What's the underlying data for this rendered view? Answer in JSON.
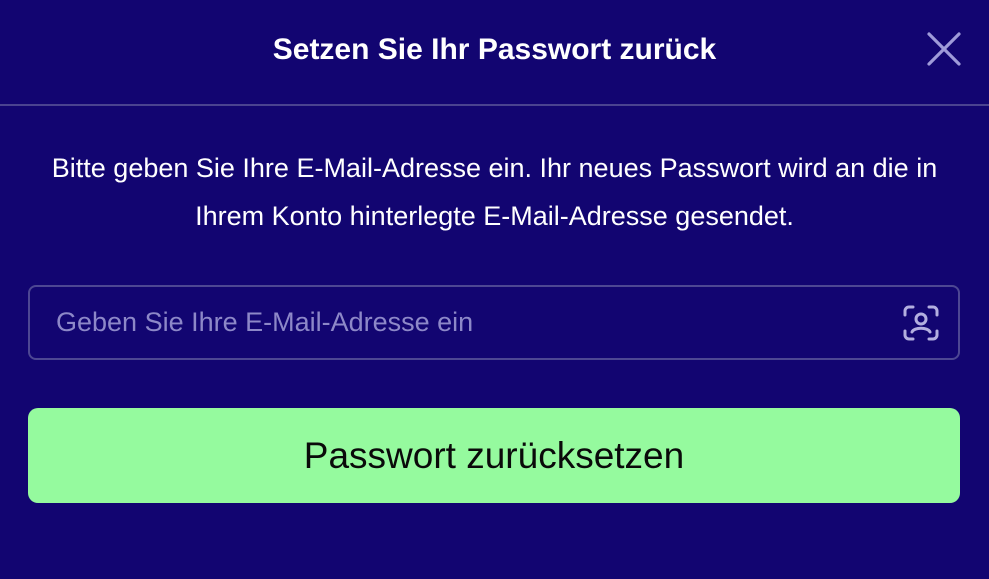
{
  "dialog": {
    "title": "Setzen Sie Ihr Passwort zurück",
    "close_icon": "close-icon",
    "description": "Bitte geben Sie Ihre E-Mail-Adresse ein. Ihr neues Passwort wird an die in Ihrem Konto hinterlegte E-Mail-Adresse gesendet.",
    "email": {
      "value": "",
      "placeholder": "Geben Sie Ihre E-Mail-Adresse ein",
      "icon": "contact-card-icon"
    },
    "submit_label": "Passwort zurücksetzen"
  },
  "colors": {
    "background": "#120571",
    "divider": "#4a4390",
    "input_border": "#4d4793",
    "placeholder": "#8d88c8",
    "close_icon": "#9f9bd9",
    "button": "#95fa9e",
    "button_text": "#0a0a0a",
    "text": "#ffffff"
  }
}
